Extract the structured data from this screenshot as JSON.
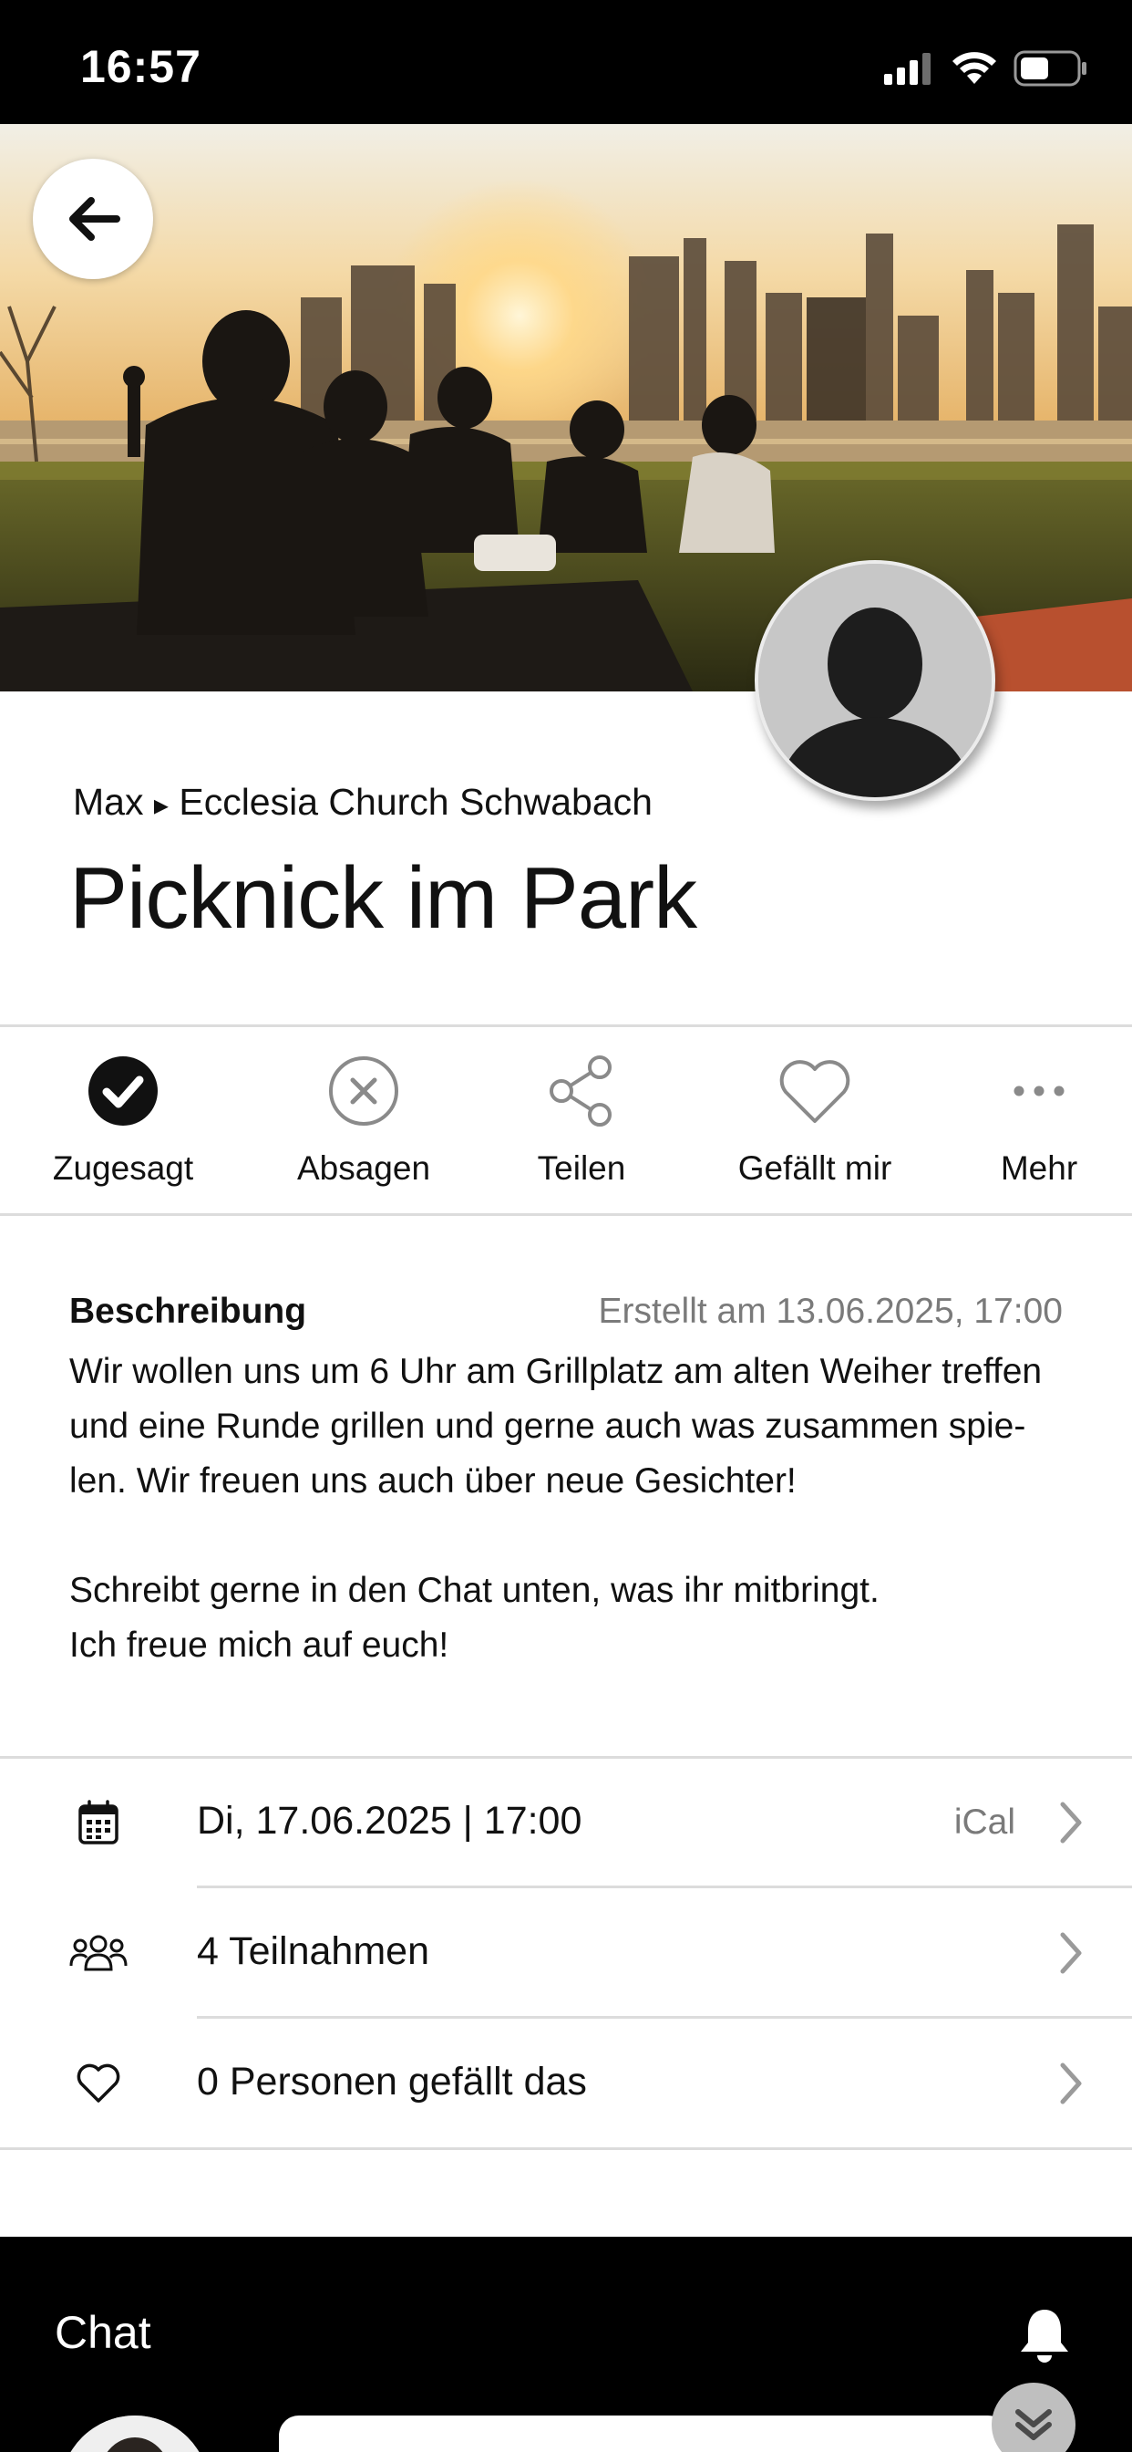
{
  "status_bar": {
    "time": "16:57",
    "icons": [
      "signal-icon",
      "wifi-icon",
      "battery-icon"
    ]
  },
  "header": {
    "breadcrumb_author": "Max",
    "breadcrumb_separator": "▸",
    "breadcrumb_group": "Ecclesia Church Schwabach",
    "title": "Picknick im Park"
  },
  "actions": [
    {
      "label": "Zugesagt",
      "icon": "check-circle-icon",
      "active": true
    },
    {
      "label": "Absagen",
      "icon": "x-circle-icon"
    },
    {
      "label": "Teilen",
      "icon": "share-icon"
    },
    {
      "label": "Gefällt mir",
      "icon": "heart-icon"
    },
    {
      "label": "Mehr",
      "icon": "more-icon"
    }
  ],
  "description": {
    "heading": "Beschreibung",
    "created": "Erstellt am 13.06.2025, 17:00",
    "lines": [
      "Wir wollen uns um 6 Uhr am Grillplatz am alten Weiher treffen",
      "und eine Runde grillen und gerne auch was zusammen spie-",
      "len. Wir freuen uns auch über neue Gesichter!",
      "",
      "Schreibt gerne in den Chat unten, was ihr mitbringt.",
      "Ich freue mich auf euch!"
    ]
  },
  "info_rows": [
    {
      "icon": "calendar-icon",
      "text": "Di, 17.06.2025 | 17:00",
      "extra": "iCal"
    },
    {
      "icon": "people-icon",
      "text": "4 Teilnahmen"
    },
    {
      "icon": "heart-outline-icon",
      "text": "0 Personen gefällt das"
    }
  ],
  "chat": {
    "title": "Chat",
    "icon": "bell-icon"
  },
  "colors": {
    "status_bar_bg": "#000000",
    "accent_dark": "#111111",
    "icon_gray": "#8a8a8a",
    "divider": "#dcdcdc",
    "chat_bg": "#000000"
  }
}
